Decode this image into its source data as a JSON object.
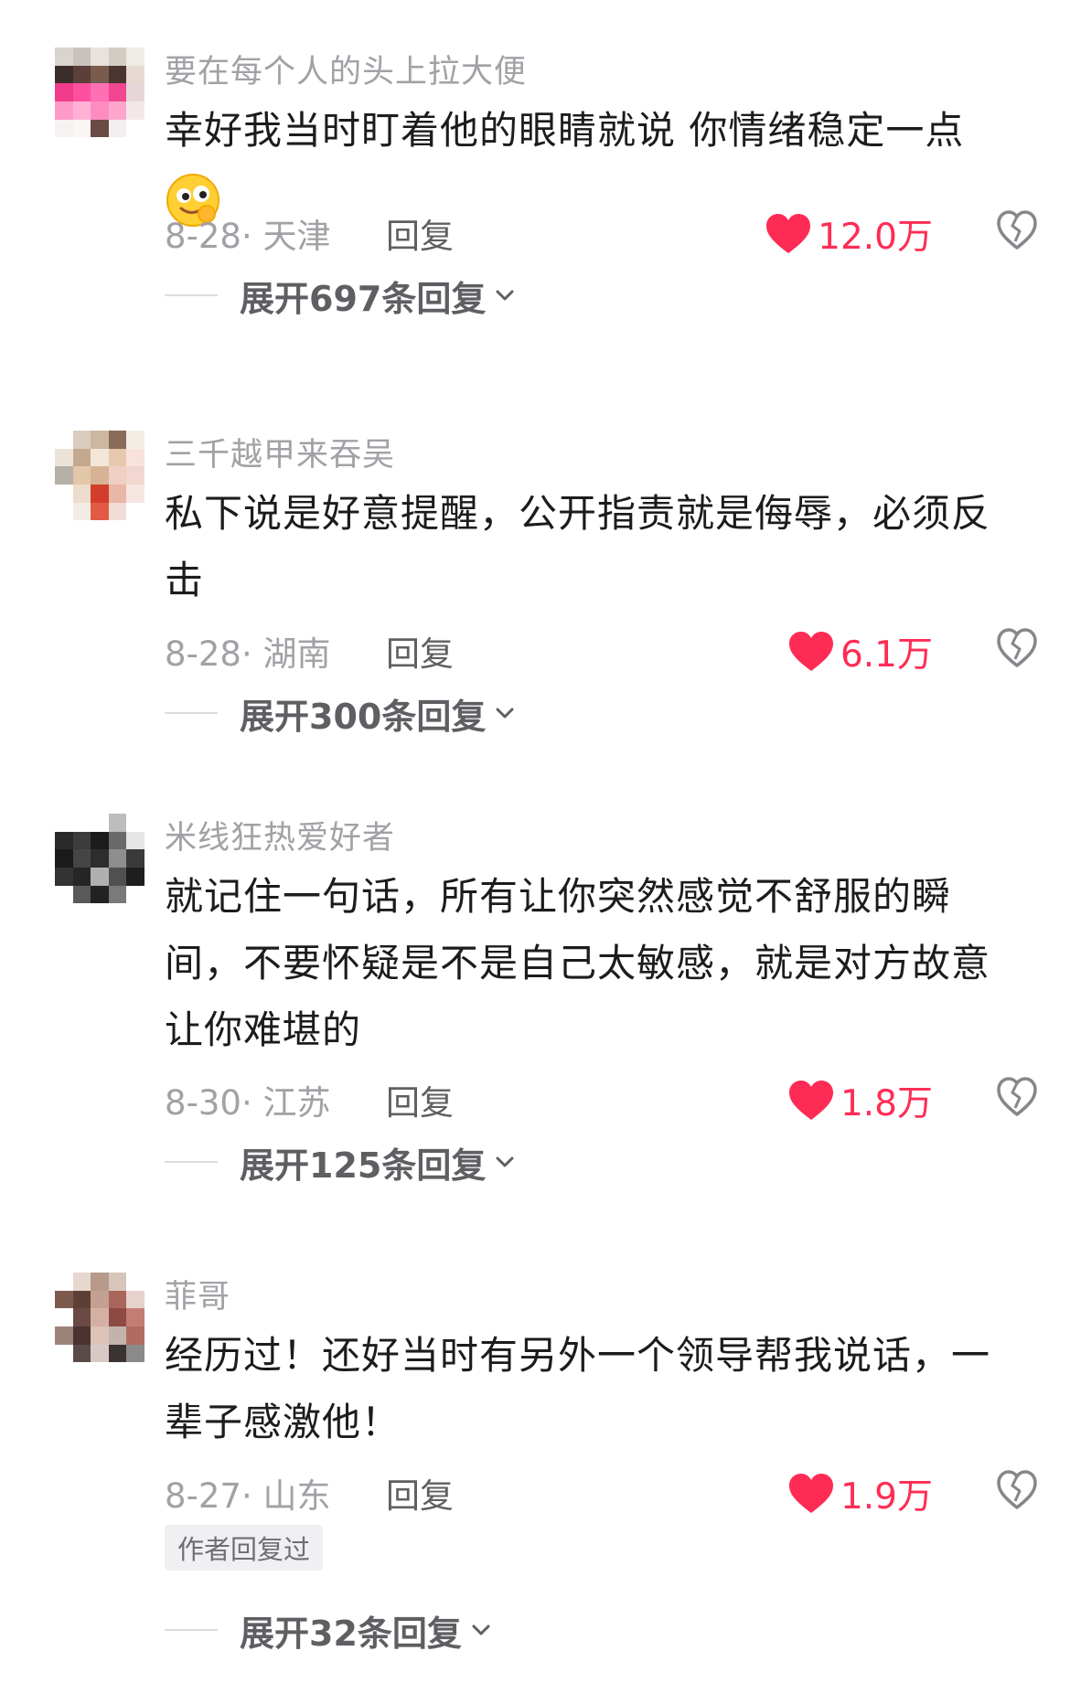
{
  "comments": [
    {
      "username": "要在每个人的头上拉大便",
      "text": "幸好我当时盯着他的眼睛就说 你情绪稳定一点",
      "emoji": "smirk-emoji",
      "date_location": "8-28· 天津",
      "reply_label": "回复",
      "likes": "12.0万",
      "expand_label": "展开697条回复"
    },
    {
      "username": "三千越甲来吞吴",
      "text": "私下说是好意提醒，公开指责就是侮辱，必须反击",
      "date_location": "8-28· 湖南",
      "reply_label": "回复",
      "likes": "6.1万",
      "expand_label": "展开300条回复"
    },
    {
      "username": "米线狂热爱好者",
      "text": "就记住一句话，所有让你突然感觉不舒服的瞬间，不要怀疑是不是自己太敏感，就是对方故意让你难堪的",
      "date_location": "8-30· 江苏",
      "reply_label": "回复",
      "likes": "1.8万",
      "expand_label": "展开125条回复"
    },
    {
      "username": "菲哥",
      "text": "经历过！还好当时有另外一个领导帮我说话，一辈子感激他！",
      "date_location": "8-27· 山东",
      "reply_label": "回复",
      "likes": "1.9万",
      "author_badge": "作者回复过",
      "expand_label": "展开32条回复"
    }
  ],
  "colors": {
    "like_red": "#fe2c55",
    "muted_text": "#a1a1a6",
    "body_text": "#1c1c1e"
  },
  "icons": {
    "like": "heart-icon",
    "dislike": "broken-heart-icon",
    "expand": "chevron-down-icon"
  }
}
